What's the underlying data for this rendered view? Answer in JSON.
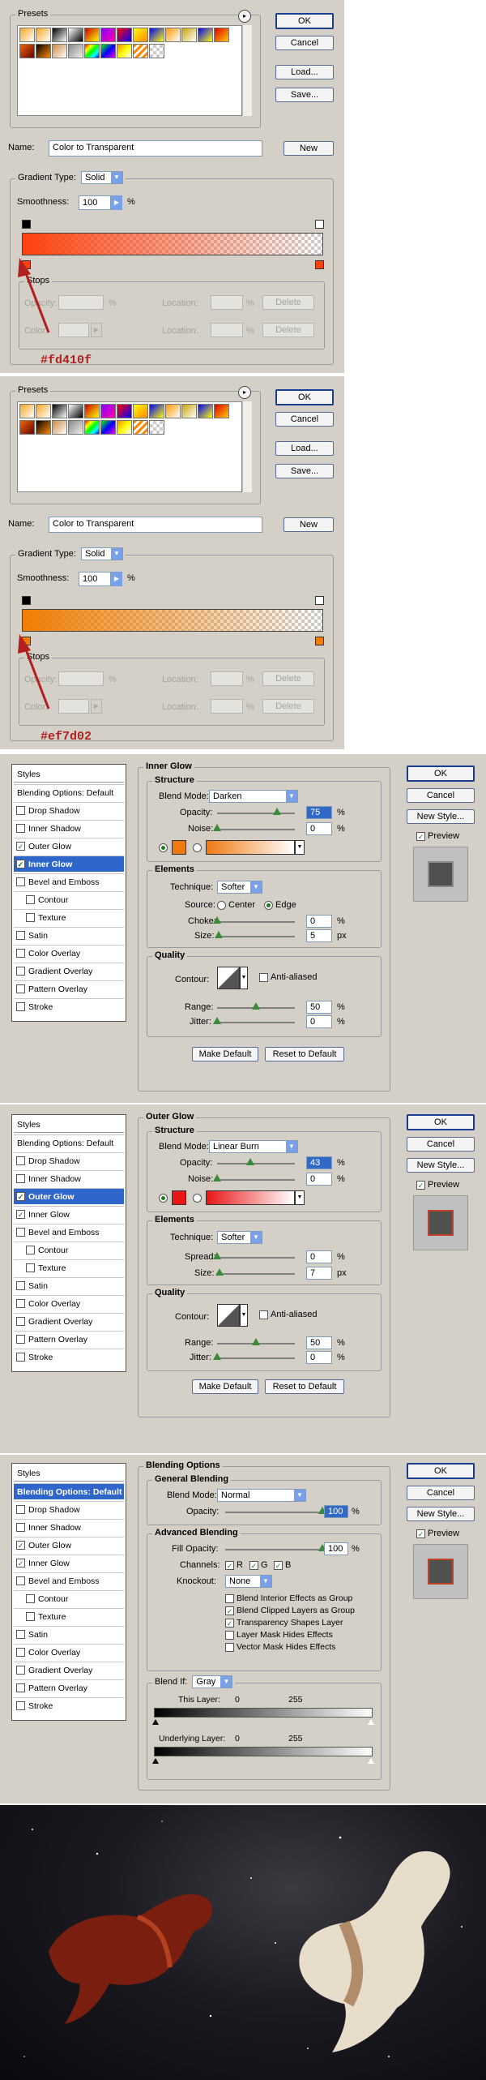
{
  "gradient_editors": [
    {
      "presets_label": "Presets",
      "ok": "OK",
      "cancel": "Cancel",
      "load": "Load...",
      "save": "Save...",
      "name_label": "Name:",
      "name_value": "Color to Transparent",
      "new": "New",
      "gradient_type_label": "Gradient Type:",
      "gradient_type_value": "Solid",
      "smoothness_label": "Smoothness:",
      "smoothness_value": "100",
      "percent": "%",
      "stops_label": "Stops",
      "opacity_label": "Opacity:",
      "location_label": "Location:",
      "color_label": "Color:",
      "delete": "Delete",
      "annotation": "#fd410f",
      "stop_color": "#fd410f"
    },
    {
      "presets_label": "Presets",
      "ok": "OK",
      "cancel": "Cancel",
      "load": "Load...",
      "save": "Save...",
      "name_label": "Name:",
      "name_value": "Color to Transparent",
      "new": "New",
      "gradient_type_label": "Gradient Type:",
      "gradient_type_value": "Solid",
      "smoothness_label": "Smoothness:",
      "smoothness_value": "100",
      "percent": "%",
      "stops_label": "Stops",
      "opacity_label": "Opacity:",
      "location_label": "Location:",
      "color_label": "Color:",
      "delete": "Delete",
      "annotation": "#ef7d02",
      "stop_color": "#ef7d02"
    }
  ],
  "layer_style_list": {
    "styles": "Styles",
    "blending_options": "Blending Options: Default",
    "drop_shadow": "Drop Shadow",
    "inner_shadow": "Inner Shadow",
    "outer_glow": "Outer Glow",
    "inner_glow": "Inner Glow",
    "bevel_emboss": "Bevel and Emboss",
    "contour": "Contour",
    "texture": "Texture",
    "satin": "Satin",
    "color_overlay": "Color Overlay",
    "gradient_overlay": "Gradient Overlay",
    "pattern_overlay": "Pattern Overlay",
    "stroke": "Stroke"
  },
  "dialog_buttons": {
    "ok": "OK",
    "cancel": "Cancel",
    "new_style": "New Style...",
    "preview": "Preview"
  },
  "inner_glow": {
    "title": "Inner Glow",
    "structure": "Structure",
    "blend_mode_label": "Blend Mode:",
    "blend_mode": "Darken",
    "opacity_label": "Opacity:",
    "opacity": "75",
    "noise_label": "Noise:",
    "noise": "0",
    "glow_color": "#f07a12",
    "elements": "Elements",
    "technique_label": "Technique:",
    "technique": "Softer",
    "source_label": "Source:",
    "center": "Center",
    "edge": "Edge",
    "choke_label": "Choke:",
    "choke": "0",
    "size_label": "Size:",
    "size": "5",
    "px": "px",
    "quality": "Quality",
    "contour_label": "Contour:",
    "anti_aliased": "Anti-aliased",
    "range_label": "Range:",
    "range": "50",
    "jitter_label": "Jitter:",
    "jitter": "0",
    "make_default": "Make Default",
    "reset_default": "Reset to Default",
    "percent": "%"
  },
  "outer_glow": {
    "title": "Outer Glow",
    "structure": "Structure",
    "blend_mode_label": "Blend Mode:",
    "blend_mode": "Linear Burn",
    "opacity_label": "Opacity:",
    "opacity": "43",
    "noise_label": "Noise:",
    "noise": "0",
    "glow_color": "#e81616",
    "elements": "Elements",
    "technique_label": "Technique:",
    "technique": "Softer",
    "spread_label": "Spread:",
    "spread": "0",
    "size_label": "Size:",
    "size": "7",
    "px": "px",
    "quality": "Quality",
    "contour_label": "Contour:",
    "anti_aliased": "Anti-aliased",
    "range_label": "Range:",
    "range": "50",
    "jitter_label": "Jitter:",
    "jitter": "0",
    "make_default": "Make Default",
    "reset_default": "Reset to Default",
    "percent": "%"
  },
  "blending": {
    "title": "Blending Options",
    "general": "General Blending",
    "blend_mode_label": "Blend Mode:",
    "blend_mode": "Normal",
    "opacity_label": "Opacity:",
    "opacity": "100",
    "advanced": "Advanced Blending",
    "fill_opacity_label": "Fill Opacity:",
    "fill_opacity": "100",
    "channels_label": "Channels:",
    "r": "R",
    "g": "G",
    "b": "B",
    "knockout_label": "Knockout:",
    "knockout": "None",
    "opt1": "Blend Interior Effects as Group",
    "opt2": "Blend Clipped Layers as Group",
    "opt3": "Transparency Shapes Layer",
    "opt4": "Layer Mask Hides Effects",
    "opt5": "Vector Mask Hides Effects",
    "blend_if_label": "Blend If:",
    "blend_if": "Gray",
    "this_layer": "This Layer:",
    "underlying": "Underlying Layer:",
    "v0": "0",
    "v255": "255",
    "percent": "%"
  }
}
